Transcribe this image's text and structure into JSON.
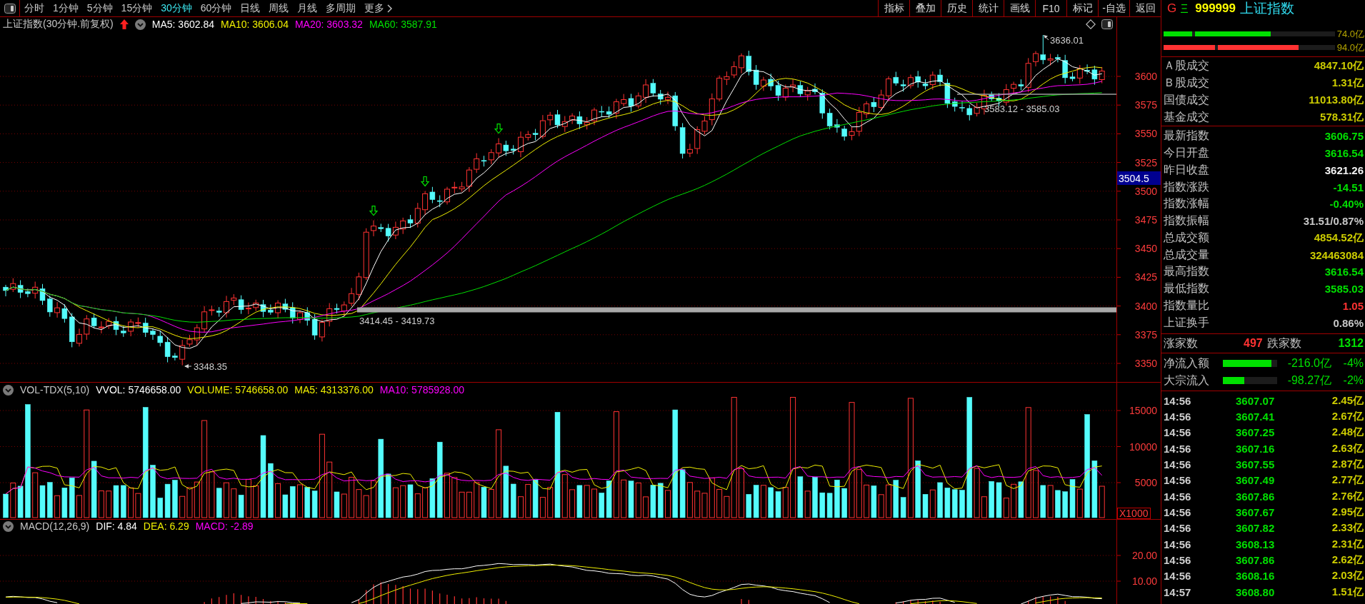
{
  "toolbar": {
    "periods": [
      {
        "label": "分时",
        "kind": "period",
        "selected": false
      },
      {
        "label": "1分钟",
        "kind": "period",
        "selected": false
      },
      {
        "label": "5分钟",
        "kind": "period",
        "selected": false
      },
      {
        "label": "15分钟",
        "kind": "period",
        "selected": false
      },
      {
        "label": "30分钟",
        "kind": "period",
        "selected": true
      },
      {
        "label": "60分钟",
        "kind": "period",
        "selected": false
      },
      {
        "label": "日线",
        "kind": "period",
        "selected": false
      },
      {
        "label": "周线",
        "kind": "period",
        "selected": false
      },
      {
        "label": "月线",
        "kind": "period",
        "selected": false
      },
      {
        "label": "多周期",
        "kind": "period",
        "selected": false
      },
      {
        "label": "更多",
        "kind": "menu",
        "selected": false
      }
    ],
    "tools": [
      "指标",
      "叠加",
      "历史",
      "统计",
      "画线",
      "F10",
      "标记",
      "-自选",
      "返回"
    ]
  },
  "price_panel": {
    "title": "上证指数(30分钟.前复权)",
    "indicators": [
      {
        "label": "MA5: 3602.84",
        "color": "#ffffff"
      },
      {
        "label": "MA10: 3606.04",
        "color": "#f0f000"
      },
      {
        "label": "MA20: 3603.32",
        "color": "#ff00ff"
      },
      {
        "label": "MA60: 3587.91",
        "color": "#00e000"
      }
    ],
    "axis_ticks": [
      "3600",
      "3575",
      "3550",
      "3525",
      "3500",
      "3475",
      "3450",
      "3425",
      "3400",
      "3375",
      "3350"
    ],
    "cursor_price": "3504.5",
    "levels": [
      {
        "label": "3583.12 - 3585.03",
        "kind": "line"
      },
      {
        "label": "3414.45 - 3419.73",
        "kind": "band"
      }
    ],
    "extremes": [
      {
        "label": "3636.01",
        "kind": "high"
      },
      {
        "label": "3348.35",
        "kind": "low"
      }
    ]
  },
  "volume_panel": {
    "title": "VOL-TDX(5,10)",
    "indicators": [
      {
        "label": "VVOL: 5746658.00",
        "color": "#ffffff"
      },
      {
        "label": "VOLUME: 5746658.00",
        "color": "#f0f000"
      },
      {
        "label": "MA5: 4313376.00",
        "color": "#f0f000"
      },
      {
        "label": "MA10: 5785928.00",
        "color": "#ff00ff"
      }
    ],
    "axis_ticks": [
      "15000",
      "10000",
      "5000"
    ],
    "unit": "X1000"
  },
  "macd_panel": {
    "title": "MACD(12,26,9)",
    "indicators": [
      {
        "label": "DIF: 4.84",
        "color": "#ffffff"
      },
      {
        "label": "DEA: 6.29",
        "color": "#f0f000"
      },
      {
        "label": "MACD: -2.89",
        "color": "#ff00ff"
      }
    ],
    "axis_ticks": [
      "20.00",
      "10.00"
    ]
  },
  "quote_panel": {
    "market": "G",
    "code": "999999",
    "name": "上证指数",
    "ratio_bars": [
      {
        "value": "74.0亿",
        "color": "#00e000",
        "segments": [
          {
            "level": 0.165
          },
          {
            "level": 0.54
          }
        ]
      },
      {
        "value": "94.0亿",
        "color": "#ff3232",
        "segments": [
          {
            "level": 0.3
          },
          {
            "level": 0.69
          }
        ]
      }
    ],
    "turnover": [
      {
        "label": "Ａ股成交",
        "value": "4847.10亿"
      },
      {
        "label": "Ｂ股成交",
        "value": "1.31亿"
      },
      {
        "label": "国债成交",
        "value": "11013.80亿"
      },
      {
        "label": "基金成交",
        "value": "578.31亿"
      }
    ],
    "index_stats": [
      {
        "label": "最新指数",
        "value": "3606.75",
        "color": "#00e000"
      },
      {
        "label": "今日开盘",
        "value": "3616.54",
        "color": "#00e000"
      },
      {
        "label": "昨日收盘",
        "value": "3621.26",
        "color": "#f0f0f0"
      },
      {
        "label": "指数涨跌",
        "value": "-14.51",
        "color": "#00e000"
      },
      {
        "label": "指数涨幅",
        "value": "-0.40%",
        "color": "#00e000"
      },
      {
        "label": "指数振幅",
        "value": "31.51/0.87%",
        "color": "#c8c8c8"
      },
      {
        "label": "总成交额",
        "value": "4854.52亿",
        "color": "#cccc00"
      },
      {
        "label": "总成交量",
        "value": "324463084",
        "color": "#cccc00"
      },
      {
        "label": "最高指数",
        "value": "3616.54",
        "color": "#00e000"
      },
      {
        "label": "最低指数",
        "value": "3585.03",
        "color": "#00e000"
      },
      {
        "label": "指数量比",
        "value": "1.05",
        "color": "#ff3232"
      },
      {
        "label": "上证换手",
        "value": "0.86%",
        "color": "#c8c8c8"
      }
    ],
    "breadth": {
      "up_label": "涨家数",
      "up_count": "497",
      "down_label": "跌家数",
      "down_count": "1312"
    },
    "flows": [
      {
        "label": "净流入额",
        "level": 0.9,
        "amount": "-216.0亿",
        "percent": "-4%"
      },
      {
        "label": "大宗流入",
        "level": 0.4,
        "amount": "-98.27亿",
        "percent": "-2%"
      }
    ],
    "ticks": [
      {
        "time": "14:56",
        "price": "3607.07",
        "amount": "2.45亿"
      },
      {
        "time": "14:56",
        "price": "3607.41",
        "amount": "2.67亿"
      },
      {
        "time": "14:56",
        "price": "3607.25",
        "amount": "2.48亿"
      },
      {
        "time": "14:56",
        "price": "3607.16",
        "amount": "2.63亿"
      },
      {
        "time": "14:56",
        "price": "3607.55",
        "amount": "2.87亿"
      },
      {
        "time": "14:56",
        "price": "3607.49",
        "amount": "2.77亿"
      },
      {
        "time": "14:56",
        "price": "3607.86",
        "amount": "2.76亿"
      },
      {
        "time": "14:56",
        "price": "3607.67",
        "amount": "2.95亿"
      },
      {
        "time": "14:56",
        "price": "3607.82",
        "amount": "2.33亿"
      },
      {
        "time": "14:56",
        "price": "3608.13",
        "amount": "2.31亿"
      },
      {
        "time": "14:56",
        "price": "3607.86",
        "amount": "2.62亿"
      },
      {
        "time": "14:56",
        "price": "3608.16",
        "amount": "2.03亿"
      },
      {
        "time": "14:57",
        "price": "3608.80",
        "amount": "1.51亿"
      }
    ]
  }
}
